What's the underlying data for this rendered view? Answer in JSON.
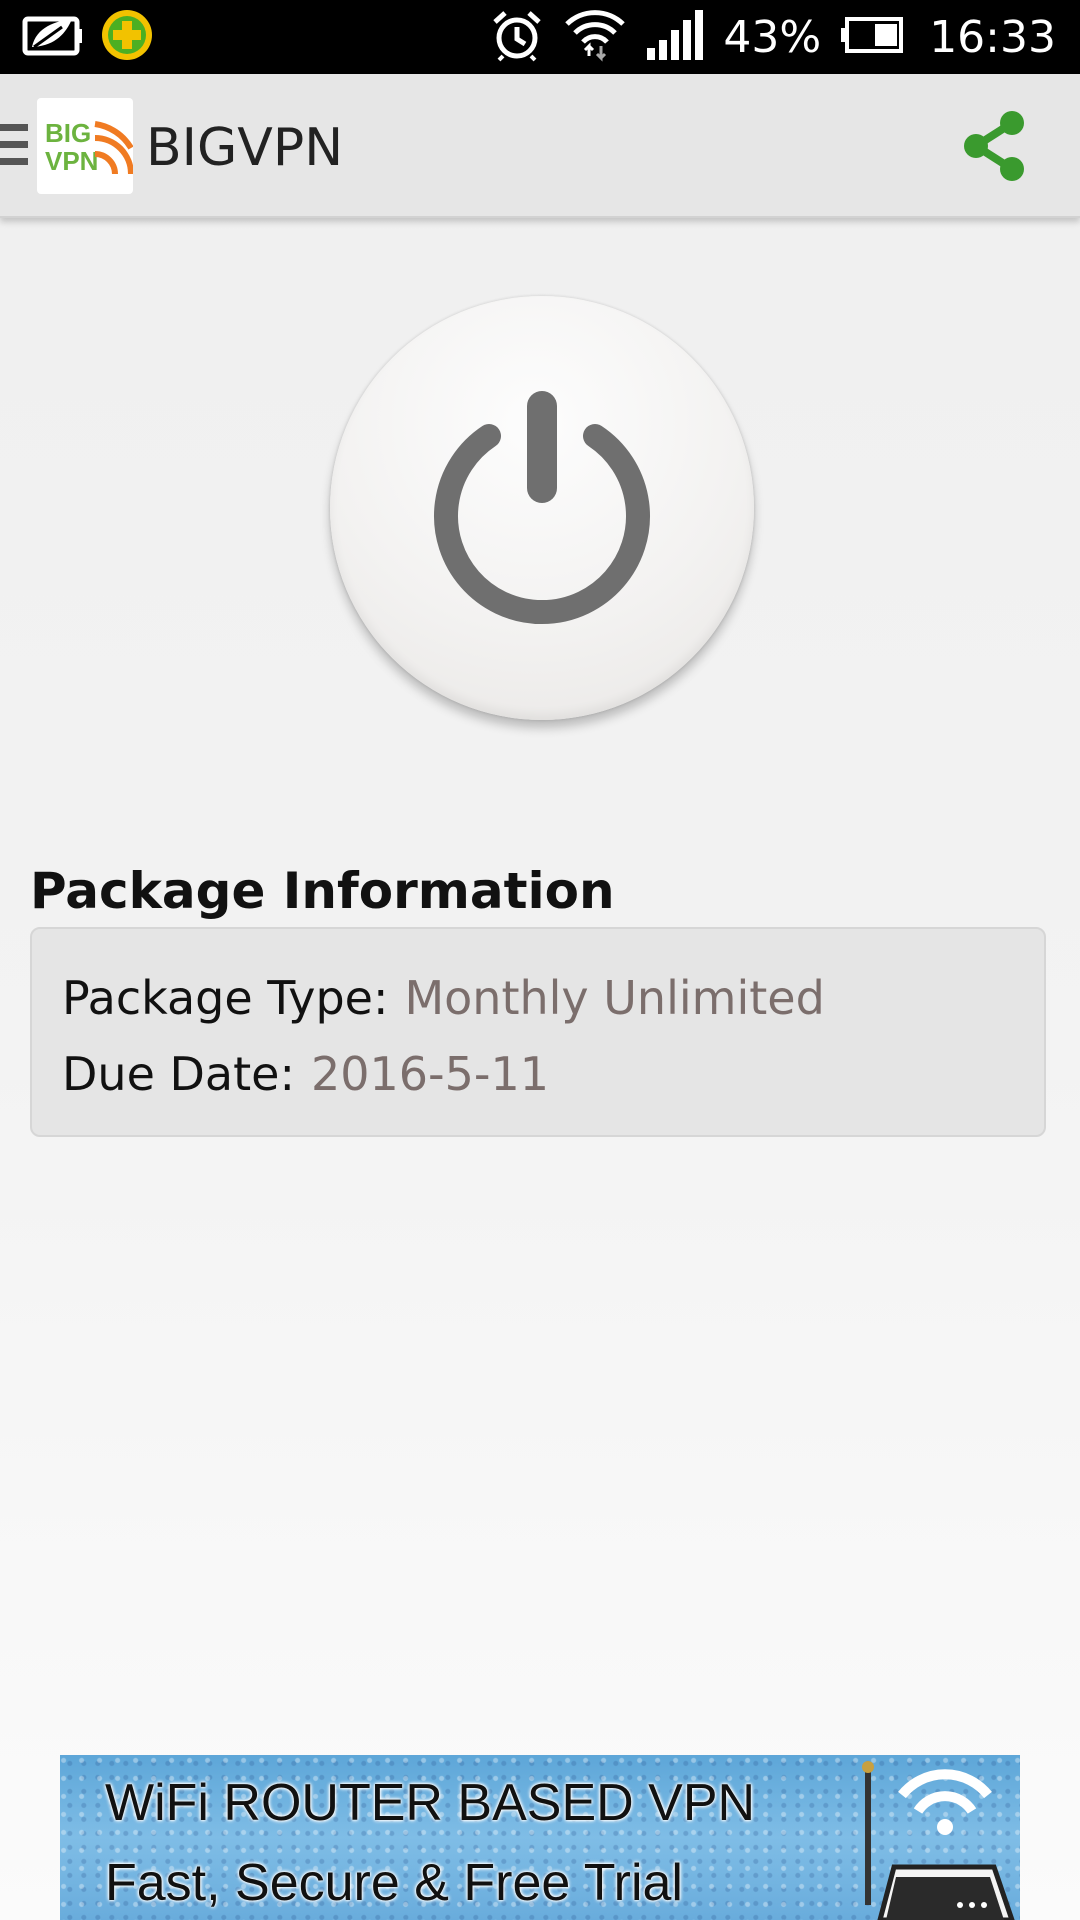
{
  "status_bar": {
    "battery_percent": "43%",
    "time": "16:33",
    "icons": [
      "notification-leaf-icon",
      "security-app-icon",
      "alarm-icon",
      "wifi-icon",
      "signal-icon",
      "battery-icon"
    ]
  },
  "app_bar": {
    "title": "BIGVPN",
    "logo_text_top": "BIG",
    "logo_text_bottom": "VPN",
    "accent_color": "#3a9a2e",
    "icons": [
      "menu-icon",
      "share-icon"
    ]
  },
  "power_button": {
    "icon": "power-icon",
    "state": "off"
  },
  "package_info": {
    "heading": "Package Information",
    "package_type_label": "Package Type:",
    "package_type_value": "Monthly Unlimited",
    "due_date_label": "Due Date:",
    "due_date_value": "2016-5-11"
  },
  "ad_banner": {
    "line1": "WiFi ROUTER BASED VPN",
    "line2": "Fast,  Secure & Free Trial",
    "icon": "wifi-router-icon"
  }
}
